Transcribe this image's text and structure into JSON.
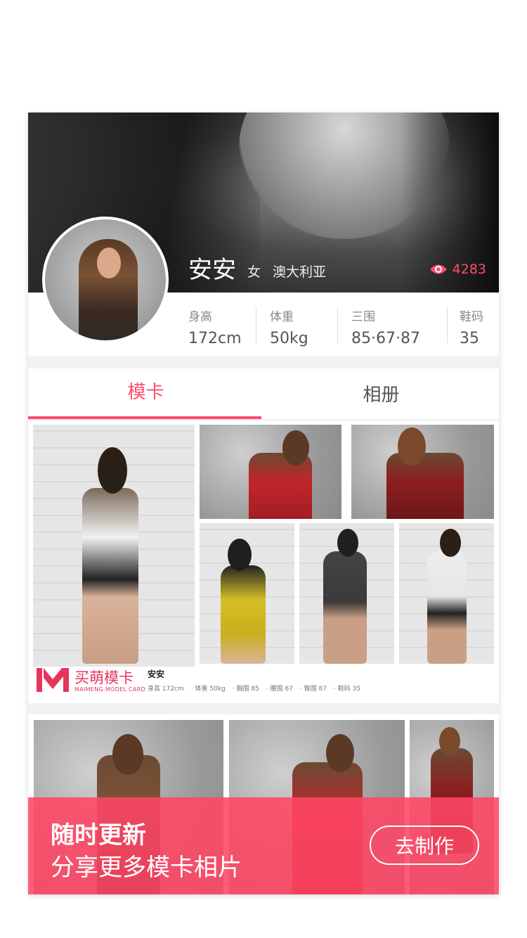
{
  "profile": {
    "name": "安安",
    "gender": "女",
    "location": "澳大利亚",
    "views": "4283",
    "stats": [
      {
        "label": "身高",
        "value": "172cm"
      },
      {
        "label": "体重",
        "value": "50kg"
      },
      {
        "label": "三围",
        "value": "85·67·87"
      },
      {
        "label": "鞋码",
        "value": "35"
      }
    ]
  },
  "tabs": [
    {
      "label": "模卡",
      "active": true
    },
    {
      "label": "相册",
      "active": false
    }
  ],
  "model_card": {
    "brand": "买萌模卡",
    "brand_en": "MAIMENG MODEL CARD",
    "name": "安安",
    "stats": [
      "身高 172cm",
      "体重 50kg",
      "胸围 85",
      "腰围 67",
      "臀围 87",
      "鞋码 35"
    ]
  },
  "banner": {
    "title": "随时更新",
    "subtitle": "分享更多模卡相片",
    "button": "去制作"
  },
  "colors": {
    "accent": "#ff4d6d",
    "brand": "#e6355b"
  },
  "icons": {
    "views": "eye-icon"
  }
}
